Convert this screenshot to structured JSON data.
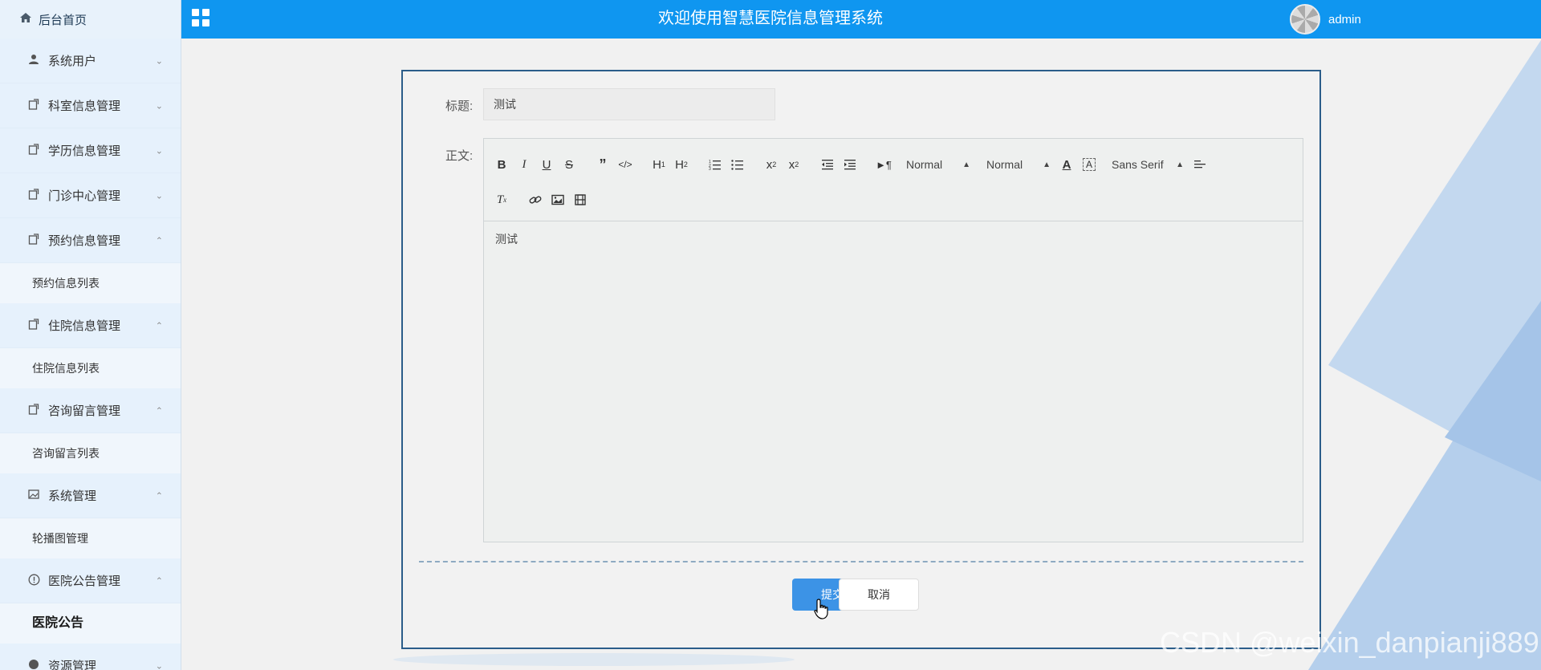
{
  "header": {
    "brand": "后台首页",
    "title": "欢迎使用智慧医院信息管理系统",
    "username": "admin",
    "brand_color": "#0f96f0"
  },
  "sidebar": {
    "items": [
      {
        "label": "系统用户",
        "icon": "user-icon",
        "chevron": "down"
      },
      {
        "label": "科室信息管理",
        "icon": "folder-icon",
        "chevron": "down"
      },
      {
        "label": "学历信息管理",
        "icon": "folder-icon",
        "chevron": "down"
      },
      {
        "label": "门诊中心管理",
        "icon": "folder-icon",
        "chevron": "down"
      },
      {
        "label": "预约信息管理",
        "icon": "folder-icon",
        "chevron": "up",
        "sub": "预约信息列表"
      },
      {
        "label": "住院信息管理",
        "icon": "folder-icon",
        "chevron": "up",
        "sub": "住院信息列表"
      },
      {
        "label": "咨询留言管理",
        "icon": "folder-icon",
        "chevron": "up",
        "sub": "咨询留言列表"
      },
      {
        "label": "系统管理",
        "icon": "image-icon",
        "chevron": "up",
        "sub": "轮播图管理"
      },
      {
        "label": "医院公告管理",
        "icon": "info-icon",
        "chevron": "up",
        "sub": "医院公告"
      },
      {
        "label": "资源管理",
        "icon": "circle-icon",
        "chevron": "down"
      }
    ]
  },
  "form": {
    "title_label": "标题:",
    "title_value": "测试",
    "body_label": "正文:",
    "body_value": "测试",
    "submit_label": "提交",
    "cancel_label": "取消"
  },
  "editor": {
    "header_select": "Normal",
    "size_select": "Normal",
    "font_select": "Sans Serif"
  },
  "watermark": "CSDN @weixin_danpianji889"
}
